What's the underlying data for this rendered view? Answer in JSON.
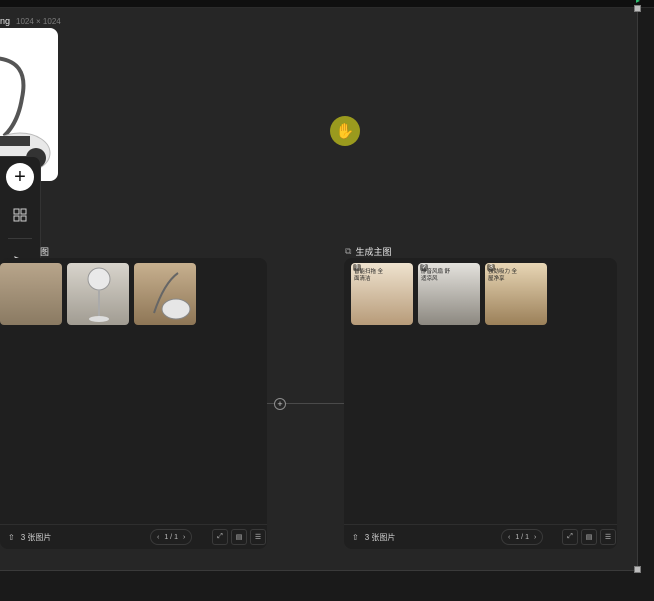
{
  "image_label": {
    "name": "ng",
    "dims": "1024 × 1024"
  },
  "left_panel": {
    "title": "图",
    "count": "3 张图片",
    "pager": "1 / 1",
    "thumbs": [
      {
        "num": "",
        "caption": ""
      },
      {
        "num": "",
        "caption": ""
      },
      {
        "num": "",
        "caption": ""
      }
    ]
  },
  "right_panel": {
    "title": "生成主图",
    "count": "3 张图片",
    "pager": "1 / 1",
    "thumbs": [
      {
        "num": "1",
        "caption": "智能扫拖 全面清洁"
      },
      {
        "num": "2",
        "caption": "静音风扇 舒适凉风"
      },
      {
        "num": "3",
        "caption": "强劲吸力 全屋净享"
      }
    ]
  },
  "toolbar": {
    "icons": [
      "plus-icon",
      "grid-icon",
      "pointer-icon",
      "hand-icon",
      "keyboard-icon",
      "help-icon"
    ]
  }
}
